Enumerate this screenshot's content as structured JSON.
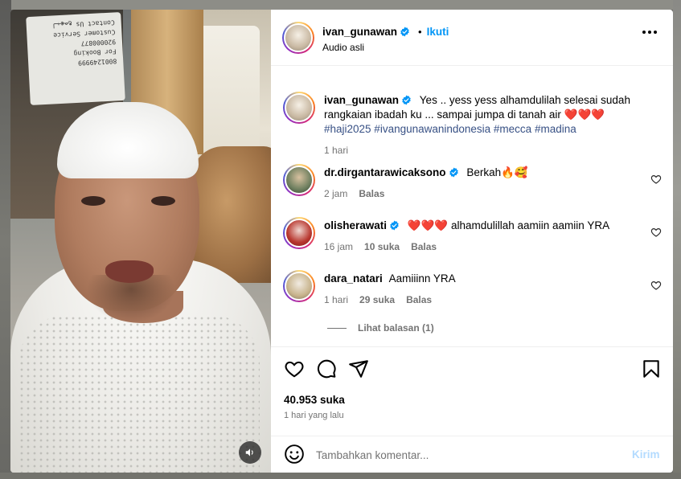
{
  "post": {
    "username": "ivan_gunawan",
    "dot": "•",
    "follow_label": "Ikuti",
    "audio": "Audio asli",
    "more_icon": "more-horizontal-icon"
  },
  "media": {
    "placard_lines": [
      "Contact Us لبهمع",
      "Customer Service",
      "920000877",
      "For Booking",
      "8001249999"
    ],
    "sound_icon": "speaker-icon"
  },
  "caption": {
    "username": "ivan_gunawan",
    "text": "Yes .. yess yess alhamdulilah selesai sudah rangkaian ibadah ku ... sampai jumpa di tanah air",
    "hearts": "❤️❤️❤️",
    "hashtags": "#haji2025 #ivangunawanindonesia #mecca #madina",
    "time": "1 hari"
  },
  "comments": [
    {
      "username": "dr.dirgantarawicaksono",
      "verified": true,
      "text": "Berkah🔥🥰",
      "time": "2 jam",
      "likes": "",
      "reply": "Balas"
    },
    {
      "username": "olisherawati",
      "verified": true,
      "text": "❤️❤️❤️ alhamdulillah aamiin aamiin YRA",
      "time": "16 jam",
      "likes": "10 suka",
      "reply": "Balas"
    },
    {
      "username": "dara_natari",
      "verified": false,
      "text": "Aamiiinn YRA",
      "time": "1 hari",
      "likes": "29 suka",
      "reply": "Balas"
    }
  ],
  "view_replies": "Lihat balasan (1)",
  "stats": {
    "likes": "40.953 suka",
    "date": "1 hari yang lalu"
  },
  "composer": {
    "placeholder": "Tambahkan komentar...",
    "send": "Kirim"
  },
  "icons": [
    "heart-icon",
    "comment-icon",
    "share-icon",
    "bookmark-icon",
    "emoji-icon",
    "verified-badge-icon"
  ],
  "colors": {
    "link": "#0095f6",
    "hashtag": "#385185",
    "muted": "#737373",
    "send_disabled": "#b3dbff"
  }
}
